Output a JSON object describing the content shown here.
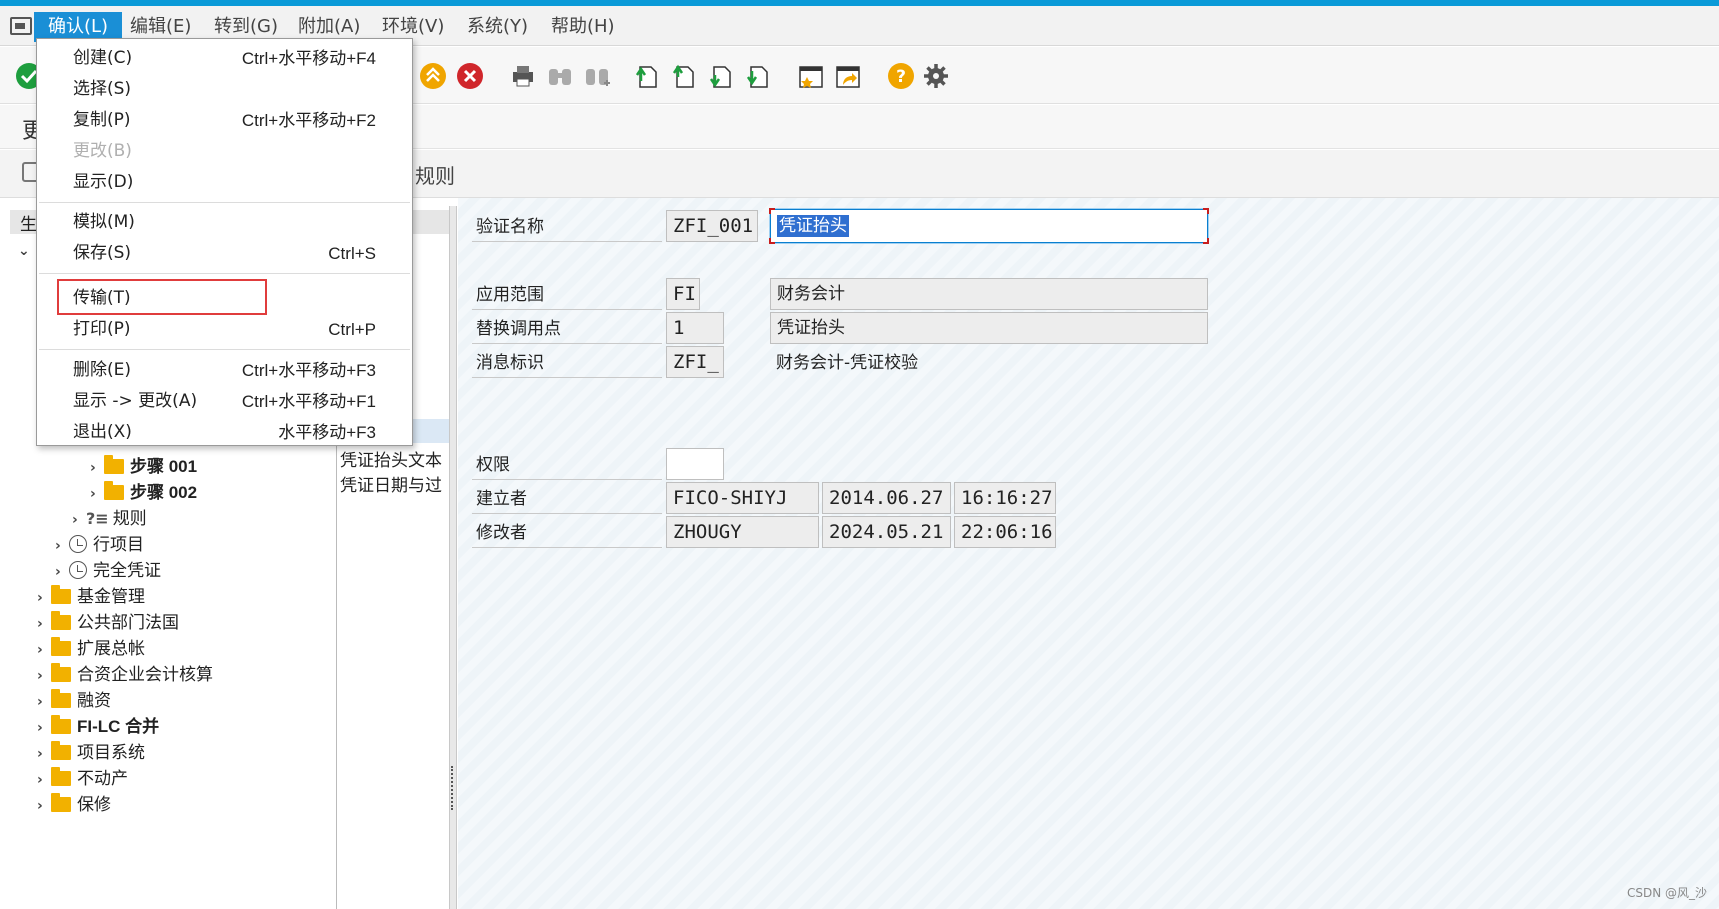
{
  "menubar": {
    "items": [
      {
        "label": "确认(L)"
      },
      {
        "label": "编辑(E)"
      },
      {
        "label": "转到(G)"
      },
      {
        "label": "附加(A)"
      },
      {
        "label": "环境(V)"
      },
      {
        "label": "系统(Y)"
      },
      {
        "label": "帮助(H)"
      }
    ],
    "active_index": 0
  },
  "dropdown": {
    "items": [
      {
        "label": "创建(C)",
        "shortcut": "Ctrl+水平移动+F4",
        "disabled": false
      },
      {
        "label": "选择(S)",
        "shortcut": "",
        "disabled": false
      },
      {
        "label": "复制(P)",
        "shortcut": "Ctrl+水平移动+F2",
        "disabled": false
      },
      {
        "label": "更改(B)",
        "shortcut": "",
        "disabled": true
      },
      {
        "label": "显示(D)",
        "shortcut": "",
        "disabled": false
      },
      {
        "label": "模拟(M)",
        "shortcut": "",
        "disabled": false
      },
      {
        "label": "保存(S)",
        "shortcut": "Ctrl+S",
        "disabled": false
      },
      {
        "label": "传输(T)",
        "shortcut": "",
        "disabled": false,
        "highlighted": true
      },
      {
        "label": "打印(P)",
        "shortcut": "Ctrl+P",
        "disabled": false
      },
      {
        "label": "删除(E)",
        "shortcut": "Ctrl+水平移动+F3",
        "disabled": false
      },
      {
        "label": "显示 -> 更改(A)",
        "shortcut": "Ctrl+水平移动+F1",
        "disabled": false
      },
      {
        "label": "退出(X)",
        "shortcut": "水平移动+F3",
        "disabled": false
      }
    ]
  },
  "toolbar": {
    "icons": [
      "enter-icon",
      "first-page-icon",
      "cancel-icon",
      "print-icon",
      "find-icon",
      "find-next-icon",
      "page-first-icon",
      "page-prev-icon",
      "page-next-icon",
      "page-last-icon",
      "bookmark-icon",
      "shortcut-icon",
      "help-icon",
      "settings-icon"
    ]
  },
  "title_row": {
    "fragment": "更"
  },
  "sub_row": {
    "tab_label": "规则"
  },
  "left_pane": {
    "header": "生",
    "tree": [
      {
        "label": "步骤 001",
        "icon": "folder-icon",
        "bold": true
      },
      {
        "label": "步骤 002",
        "icon": "folder-icon",
        "bold": true
      },
      {
        "label": "规则",
        "icon": "rule-icon",
        "bold": false
      },
      {
        "label": "行项目",
        "icon": "clock-icon",
        "bold": false
      },
      {
        "label": "完全凭证",
        "icon": "clock-icon",
        "bold": false
      },
      {
        "label": "基金管理",
        "icon": "folder-icon",
        "bold": false
      },
      {
        "label": "公共部门法国",
        "icon": "folder-icon",
        "bold": false
      },
      {
        "label": "扩展总帐",
        "icon": "folder-icon",
        "bold": false
      },
      {
        "label": "合资企业会计核算",
        "icon": "folder-icon",
        "bold": false
      },
      {
        "label": "融资",
        "icon": "folder-icon",
        "bold": false
      },
      {
        "label": "FI-LC 合并",
        "icon": "folder-icon",
        "bold": true
      },
      {
        "label": "项目系统",
        "icon": "folder-icon",
        "bold": false
      },
      {
        "label": "不动产",
        "icon": "folder-icon",
        "bold": false
      },
      {
        "label": "保修",
        "icon": "folder-icon",
        "bold": false
      }
    ]
  },
  "mid_pane": {
    "rows": [
      "凭证抬头文本",
      "凭证日期与过"
    ]
  },
  "form": {
    "validation_name": {
      "label": "验证名称",
      "code": "ZFI_001",
      "desc": "凭证抬头"
    },
    "app_area": {
      "label": "应用范围",
      "code": "FI",
      "desc": "财务会计"
    },
    "callup_point": {
      "label": "替换调用点",
      "code": "1",
      "desc": "凭证抬头"
    },
    "message_id": {
      "label": "消息标识",
      "code": "ZFI_",
      "desc": "财务会计-凭证校验"
    },
    "authorization": {
      "label": "权限",
      "code": ""
    },
    "created_by": {
      "label": "建立者",
      "user": "FICO-SHIYJ",
      "date": "2014.06.27",
      "time": "16:16:27"
    },
    "changed_by": {
      "label": "修改者",
      "user": "ZHOUGY",
      "date": "2024.05.21",
      "time": "22:06:16"
    }
  },
  "watermark": "CSDN @风_沙",
  "colors": {
    "accent": "#0a9ad8",
    "menu_active": "#1a8fd6",
    "highlight_border": "#e03c3c"
  }
}
